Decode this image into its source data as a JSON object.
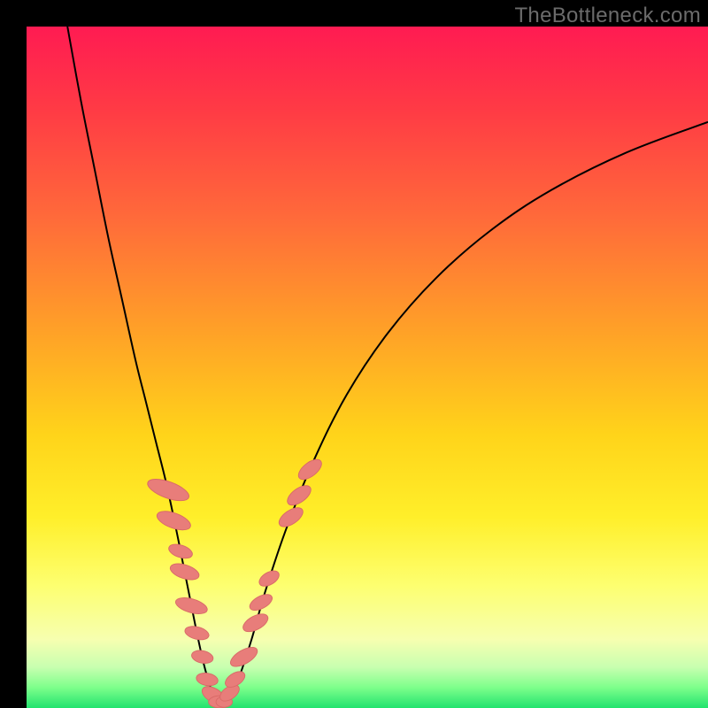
{
  "watermark": "TheBottleneck.com",
  "colors": {
    "frame": "#000000",
    "curve": "#000000",
    "marker_fill": "#e87d7a",
    "marker_stroke": "#d96a67"
  },
  "chart_data": {
    "type": "line",
    "title": "",
    "xlabel": "",
    "ylabel": "",
    "xlim": [
      0,
      100
    ],
    "ylim": [
      0,
      100
    ],
    "grid": false,
    "legend": false,
    "series": [
      {
        "name": "left-branch",
        "x": [
          6,
          8,
          10,
          12,
          14,
          16,
          17.5,
          19,
          20.5,
          22,
          23,
          24,
          25,
          26,
          27,
          27.8
        ],
        "y": [
          100,
          89,
          79,
          69,
          60,
          51,
          45,
          39,
          33,
          26,
          21,
          16,
          11,
          6.5,
          3,
          1
        ]
      },
      {
        "name": "right-branch",
        "x": [
          29.5,
          31,
          33,
          35,
          38,
          42,
          47,
          53,
          60,
          68,
          77,
          88,
          100
        ],
        "y": [
          1,
          4,
          10,
          17,
          26,
          36,
          46,
          55,
          63,
          70,
          76,
          81.5,
          86
        ]
      },
      {
        "name": "floor",
        "x": [
          27.8,
          29.5
        ],
        "y": [
          1,
          1
        ]
      }
    ],
    "markers": [
      {
        "series": "left-branch",
        "cx": 20.8,
        "cy": 32.0,
        "rx": 1.2,
        "ry": 3.2,
        "rot": -70
      },
      {
        "series": "left-branch",
        "cx": 21.6,
        "cy": 27.5,
        "rx": 1.1,
        "ry": 2.6,
        "rot": -70
      },
      {
        "series": "left-branch",
        "cx": 22.6,
        "cy": 23.0,
        "rx": 0.9,
        "ry": 1.8,
        "rot": -72
      },
      {
        "series": "left-branch",
        "cx": 23.2,
        "cy": 20.0,
        "rx": 1.0,
        "ry": 2.2,
        "rot": -72
      },
      {
        "series": "left-branch",
        "cx": 24.2,
        "cy": 15.0,
        "rx": 1.0,
        "ry": 2.4,
        "rot": -74
      },
      {
        "series": "left-branch",
        "cx": 25.0,
        "cy": 11.0,
        "rx": 0.9,
        "ry": 1.8,
        "rot": -76
      },
      {
        "series": "left-branch",
        "cx": 25.8,
        "cy": 7.5,
        "rx": 0.9,
        "ry": 1.6,
        "rot": -78
      },
      {
        "series": "left-branch",
        "cx": 26.5,
        "cy": 4.2,
        "rx": 0.9,
        "ry": 1.6,
        "rot": -80
      },
      {
        "series": "left-branch",
        "cx": 27.4,
        "cy": 1.9,
        "rx": 1.0,
        "ry": 1.8,
        "rot": -60
      },
      {
        "series": "floor",
        "cx": 28.4,
        "cy": 0.9,
        "rx": 1.7,
        "ry": 0.9,
        "rot": 0
      },
      {
        "series": "floor",
        "cx": 29.0,
        "cy": 0.9,
        "rx": 1.2,
        "ry": 0.8,
        "rot": 0
      },
      {
        "series": "right-branch",
        "cx": 29.8,
        "cy": 2.2,
        "rx": 0.9,
        "ry": 1.6,
        "rot": 55
      },
      {
        "series": "right-branch",
        "cx": 30.6,
        "cy": 4.2,
        "rx": 0.9,
        "ry": 1.6,
        "rot": 58
      },
      {
        "series": "right-branch",
        "cx": 31.9,
        "cy": 7.5,
        "rx": 1.0,
        "ry": 2.2,
        "rot": 60
      },
      {
        "series": "right-branch",
        "cx": 33.6,
        "cy": 12.5,
        "rx": 1.0,
        "ry": 2.0,
        "rot": 62
      },
      {
        "series": "right-branch",
        "cx": 34.4,
        "cy": 15.5,
        "rx": 0.9,
        "ry": 1.8,
        "rot": 62
      },
      {
        "series": "right-branch",
        "cx": 35.6,
        "cy": 19.0,
        "rx": 0.9,
        "ry": 1.6,
        "rot": 60
      },
      {
        "series": "right-branch",
        "cx": 38.8,
        "cy": 28.0,
        "rx": 1.0,
        "ry": 2.0,
        "rot": 56
      },
      {
        "series": "right-branch",
        "cx": 40.0,
        "cy": 31.2,
        "rx": 1.0,
        "ry": 2.0,
        "rot": 54
      },
      {
        "series": "right-branch",
        "cx": 41.6,
        "cy": 35.0,
        "rx": 1.0,
        "ry": 2.0,
        "rot": 52
      }
    ]
  }
}
